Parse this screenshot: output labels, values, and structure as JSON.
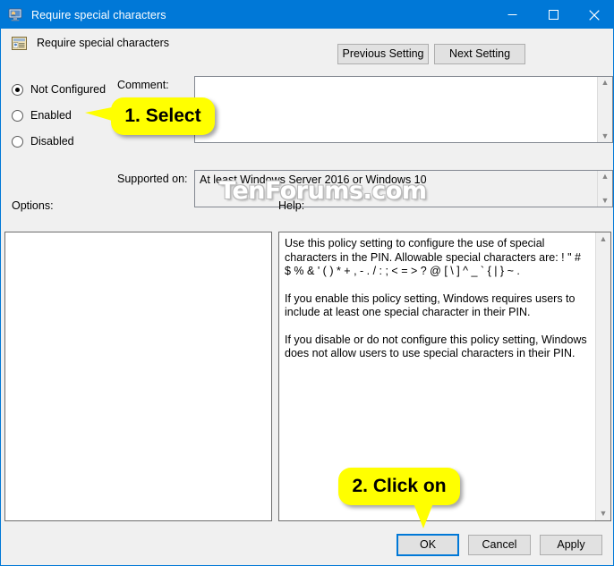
{
  "window": {
    "title": "Require special characters",
    "icon": "policy-monitor-icon",
    "minimize_label": "Minimize",
    "maximize_label": "Maximize",
    "close_label": "Close",
    "border_color": "#0078d7",
    "titlebar_color": "#0078d7"
  },
  "header": {
    "icon": "policy-setting-icon",
    "title": "Require special characters"
  },
  "nav": {
    "previous_label": "Previous Setting",
    "next_label": "Next Setting"
  },
  "state_options": {
    "items": [
      {
        "label": "Not Configured",
        "checked": true
      },
      {
        "label": "Enabled",
        "checked": false
      },
      {
        "label": "Disabled",
        "checked": false
      }
    ]
  },
  "comment": {
    "label": "Comment:",
    "value": "",
    "scroll_up_icon": "chevron-up-icon",
    "scroll_down_icon": "chevron-down-icon"
  },
  "supported": {
    "label": "Supported on:",
    "value": "At least Windows Server 2016 or Windows 10",
    "scroll_up_icon": "chevron-up-icon",
    "scroll_down_icon": "chevron-down-icon"
  },
  "options": {
    "label": "Options:",
    "content": ""
  },
  "help": {
    "label": "Help:",
    "paragraphs": [
      "Use this policy setting to configure the use of special characters in the PIN.  Allowable special characters are: ! \" # $ % & ' ( ) * + , - . / : ; < = > ? @ [ \\ ] ^ _ ` { | } ~ .",
      "If you enable this policy setting, Windows requires users to include at least one special character in their PIN.",
      "If you disable or do not configure this policy setting, Windows does not allow users to use special characters in their PIN."
    ],
    "scroll_up_icon": "chevron-up-icon",
    "scroll_down_icon": "chevron-down-icon"
  },
  "footer": {
    "ok_label": "OK",
    "cancel_label": "Cancel",
    "apply_label": "Apply"
  },
  "callouts": {
    "step1": "1. Select",
    "step2": "2. Click on",
    "color": "#ffff00"
  },
  "watermark": "TenForums.com"
}
